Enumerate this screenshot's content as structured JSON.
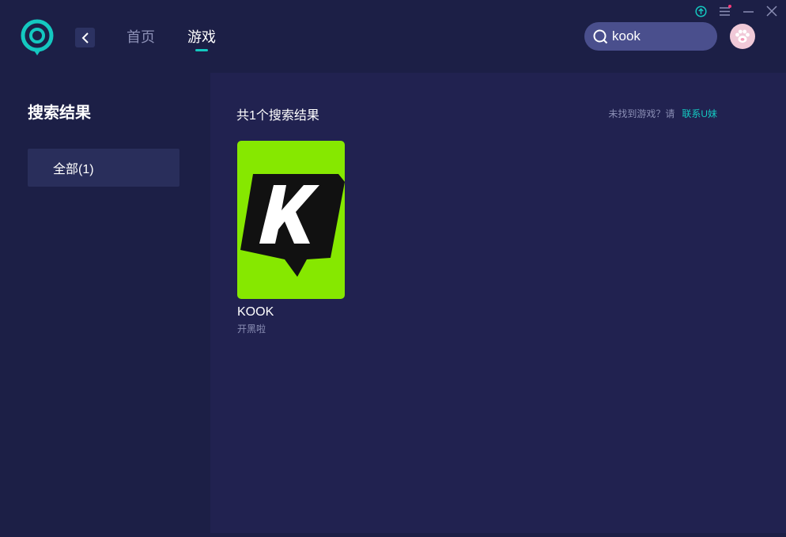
{
  "header": {
    "nav": [
      {
        "label": "首页",
        "active": false
      },
      {
        "label": "游戏",
        "active": true
      }
    ],
    "search": {
      "value": "kook",
      "placeholder": ""
    },
    "icons": {
      "logo": "app-logo-icon",
      "back": "chevron-left-icon",
      "upload": "upload-circle-icon",
      "menu": "menu-icon",
      "minimize": "minimize-icon",
      "close": "close-icon",
      "avatar": "paw-avatar-icon"
    }
  },
  "sidebar": {
    "title": "搜索结果",
    "filters": [
      {
        "label": "全部(1)",
        "selected": true
      }
    ]
  },
  "main": {
    "result_count": "共1个搜索结果",
    "not_found_text": "未找到游戏？请",
    "contact_link": "联系U妹",
    "games": [
      {
        "name": "KOOK",
        "desc": "开黑啦",
        "cover_color": "#86e800"
      }
    ]
  },
  "colors": {
    "background": "#1c1f46",
    "panel": "#212250",
    "accent": "#14c8c0",
    "muted_text": "#8b8fb5",
    "search_bg": "#4a4f8d"
  }
}
